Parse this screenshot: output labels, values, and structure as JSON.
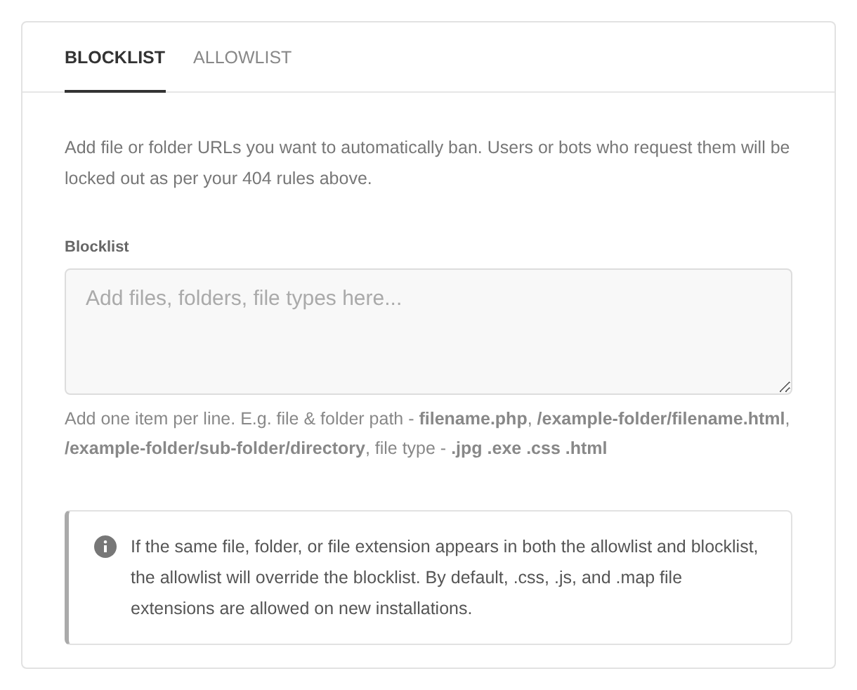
{
  "tabs": [
    {
      "label": "BLOCKLIST",
      "selected": true
    },
    {
      "label": "ALLOWLIST",
      "selected": false
    }
  ],
  "description": "Add file or folder URLs you want to automatically ban. Users or bots who request them will be locked out as per your 404 rules above.",
  "field": {
    "label": "Blocklist",
    "placeholder": "Add files, folders, file types here..."
  },
  "hint": "Add one item per line. E.g. file & folder path - **filename.php**, **/example-folder/filename.html**, **/example-folder/sub-folder/directory**, file type - **.jpg .exe .css .html**",
  "notice": {
    "text": "If the same file, folder, or file extension appears in both the allowlist and blocklist, the allowlist will override the blocklist. By default, .css, .js, and .map file extensions are allowed on new installations."
  }
}
